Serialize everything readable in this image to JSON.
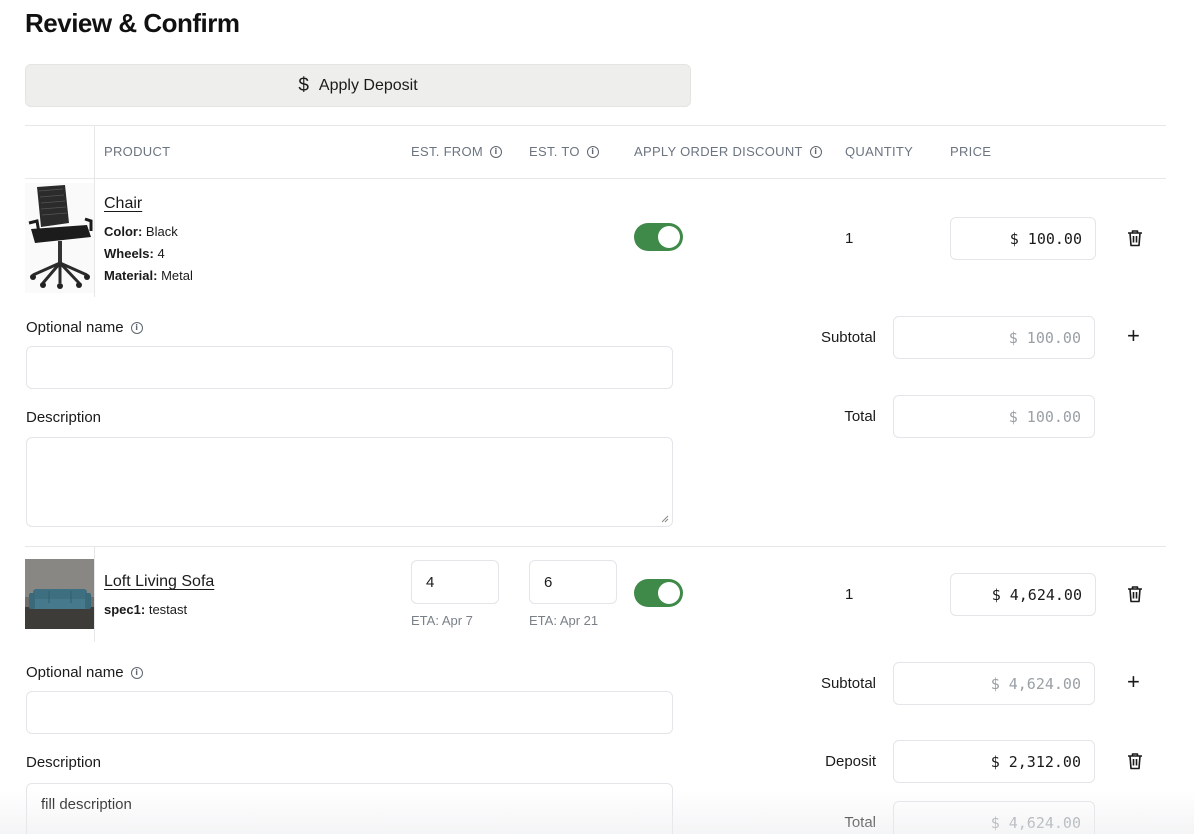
{
  "page": {
    "title": "Review & Confirm"
  },
  "deposit_button": {
    "icon": "dollar-icon",
    "label": "Apply Deposit"
  },
  "table": {
    "headers": {
      "product": "PRODUCT",
      "est_from": "EST. FROM",
      "est_to": "EST. TO",
      "apply_discount": "APPLY ORDER DISCOUNT",
      "quantity": "QUANTITY",
      "price": "PRICE"
    }
  },
  "items": [
    {
      "name": "Chair",
      "image": "office-chair-thumbnail",
      "specs": [
        {
          "key": "Color:",
          "value": "Black"
        },
        {
          "key": "Wheels:",
          "value": "4"
        },
        {
          "key": "Material:",
          "value": "Metal"
        }
      ],
      "discount_on": true,
      "quantity": "1",
      "price": "$ 100.00",
      "optional_name_label": "Optional name",
      "optional_name_value": "",
      "description_label": "Description",
      "description_value": "",
      "subtotal_label": "Subtotal",
      "subtotal": "$ 100.00",
      "total_label": "Total",
      "total": "$ 100.00"
    },
    {
      "name": "Loft Living Sofa",
      "image": "sofa-thumbnail",
      "specs": [
        {
          "key": "spec1:",
          "value": "testast"
        }
      ],
      "est_from": "4",
      "est_from_eta": "ETA: Apr 7",
      "est_to": "6",
      "est_to_eta": "ETA: Apr 21",
      "discount_on": true,
      "quantity": "1",
      "price": "$ 4,624.00",
      "optional_name_label": "Optional name",
      "optional_name_value": "",
      "description_label": "Description",
      "description_value": "fill description",
      "subtotal_label": "Subtotal",
      "subtotal": "$ 4,624.00",
      "deposit_label": "Deposit",
      "deposit": "$ 2,312.00",
      "total_label": "Total",
      "total": "$ 4,624.00"
    }
  ],
  "colors": {
    "toggle_on": "#3f8a48",
    "deposit_button_bg": "#eeefec",
    "header_text": "#6c7480",
    "muted_price": "#9aa0a6"
  }
}
